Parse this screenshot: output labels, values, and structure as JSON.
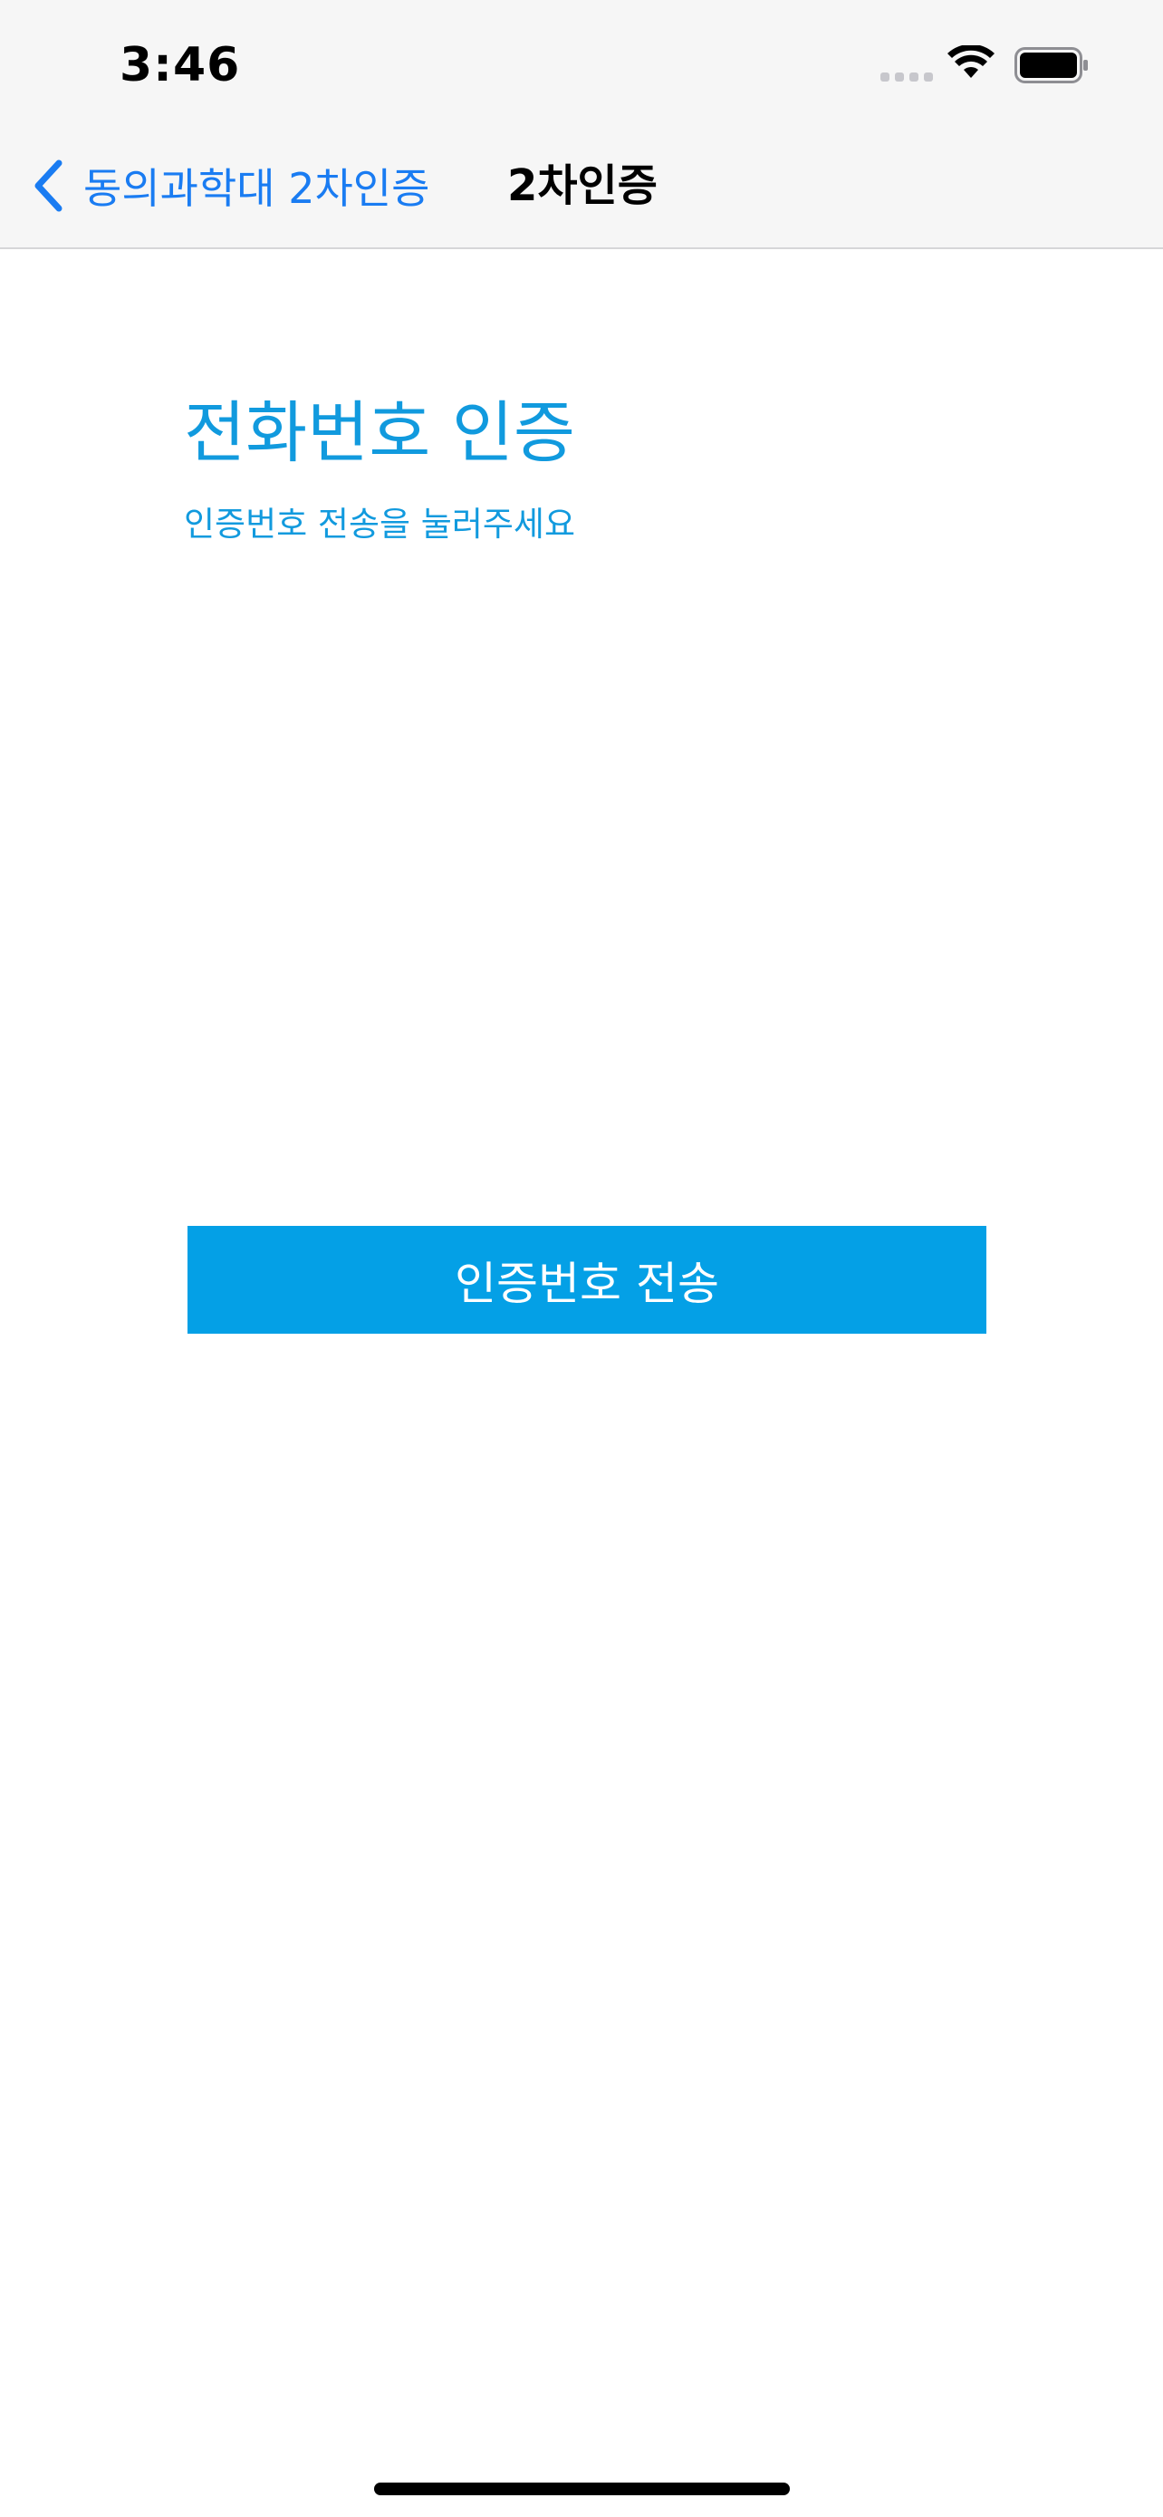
{
  "status_bar": {
    "time": "3:46",
    "signal_icon": "cellular-signal-icon",
    "wifi_icon": "wifi-icon",
    "battery_icon": "battery-icon"
  },
  "nav": {
    "back_icon": "chevron-left-icon",
    "back_label": "동의과학대 2차인증",
    "title": "2차인증"
  },
  "content": {
    "heading": "전화번호 인증",
    "subheading": "인증번호 전송을 눌러주세요",
    "send_button_label": "인증번호 전송"
  },
  "colors": {
    "accent_text": "#119ade",
    "button_bg": "#04a0e6",
    "ios_link_blue": "#1a7cf2"
  }
}
